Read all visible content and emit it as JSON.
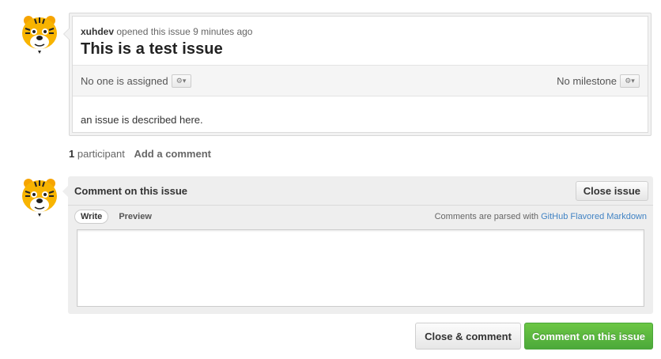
{
  "issue": {
    "author": "xuhdev",
    "meta_text": "opened this issue 9 minutes ago",
    "title": "This is a test issue",
    "assignee_text": "No one is assigned",
    "milestone_text": "No milestone",
    "body": "an issue is described here."
  },
  "participants": {
    "count": "1",
    "label": "participant",
    "add_comment": "Add a comment"
  },
  "comment_form": {
    "heading": "Comment on this issue",
    "close_issue_label": "Close issue",
    "tabs": [
      {
        "label": "Write",
        "active": true
      },
      {
        "label": "Preview",
        "active": false
      }
    ],
    "markdown_note": "Comments are parsed with",
    "markdown_link": "GitHub Flavored Markdown",
    "textarea_value": "",
    "close_and_comment_label": "Close & comment",
    "submit_label": "Comment on this issue"
  },
  "icons": {
    "avatar": "tiger-avatar-icon",
    "gear": "gear-icon"
  },
  "colors": {
    "submit_green": "#6cc644",
    "link_blue": "#4183c4"
  }
}
